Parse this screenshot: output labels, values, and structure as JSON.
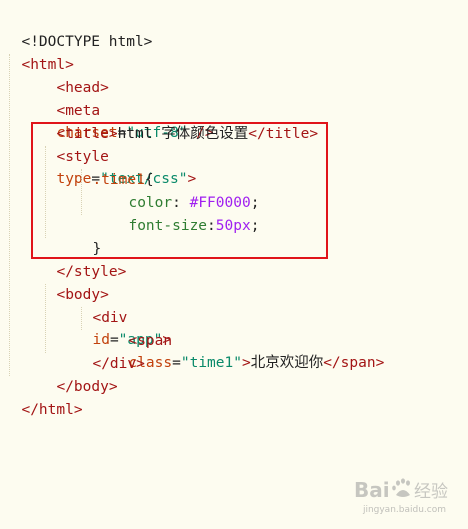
{
  "code": {
    "doctype": "<!DOCTYPE html>",
    "html_open_tag": "<html>",
    "head_open_tag": "<head>",
    "meta_open": "<meta",
    "meta_attr": "charset",
    "meta_eq": "=",
    "meta_val": "\"utf-8\"",
    "meta_close": " />",
    "title_open": "<title>",
    "title_text": "html 字体颜色设置",
    "title_close": "</title>",
    "style_open_prefix": "<style",
    "style_attr": "type",
    "style_eq": "=",
    "style_val": "\"text/css\"",
    "style_open_suffix": ">",
    "selector": ".time1",
    "brace_open": "{",
    "prop_color": "color",
    "colon1": ": ",
    "value_color": "#FF0000",
    "semi1": ";",
    "prop_font_size": "font-size",
    "colon2": ":",
    "value_font_size": "50px",
    "semi2": ";",
    "brace_close": "}",
    "style_close": "</style>",
    "body_open": "<body>",
    "div_open_prefix": "<div",
    "div_attr": "id",
    "div_eq": "=",
    "div_val": "\"app\"",
    "div_open_suffix": ">",
    "span_open_prefix": "<span",
    "span_attr": "class",
    "span_eq": "=",
    "span_val": "\"time1\"",
    "span_open_suffix": ">",
    "span_text": "北京欢迎你",
    "span_close": "</span>",
    "div_close": "</div>",
    "body_close": "</body>",
    "html_close": "</html>"
  },
  "highlight": {
    "color": "#e0141a"
  },
  "watermark": {
    "subtitle": "jingyan.baidu.com"
  },
  "colors": {
    "background": "#fdfcf0",
    "tag": "#a31515",
    "attribute": "#c2410c",
    "string": "#0a8a6a",
    "number": "#a020f0",
    "property": "#2f7d32"
  }
}
